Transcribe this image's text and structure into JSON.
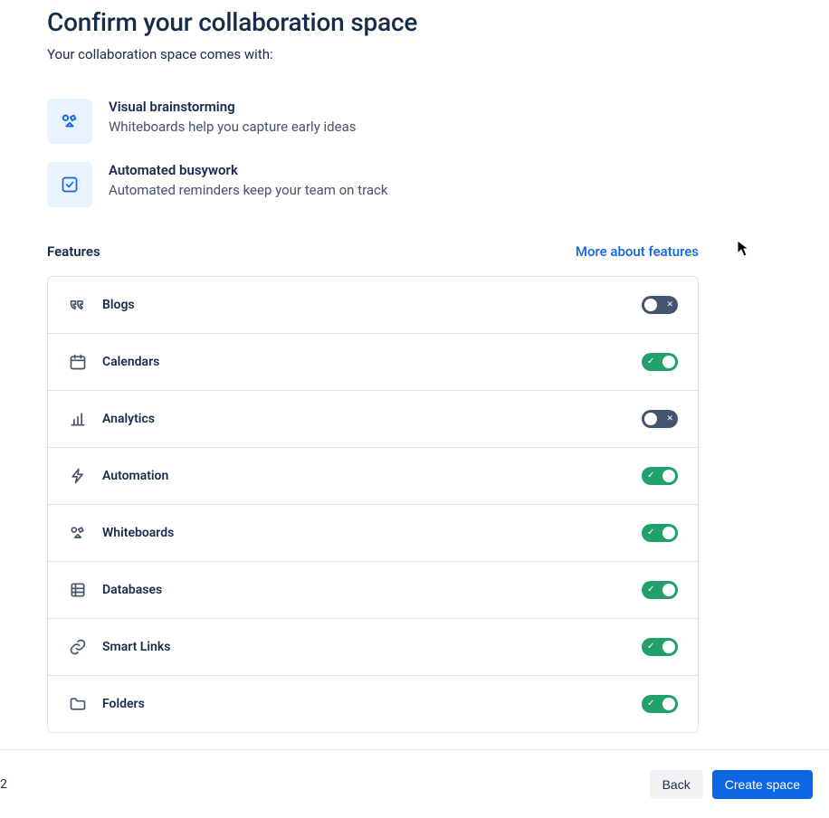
{
  "header": {
    "title": "Confirm your collaboration space",
    "subtitle": "Your collaboration space comes with:"
  },
  "included": [
    {
      "icon": "whiteboard",
      "title": "Visual brainstorming",
      "desc": "Whiteboards help you capture early ideas"
    },
    {
      "icon": "check-square",
      "title": "Automated busywork",
      "desc": "Automated reminders keep your team on track"
    }
  ],
  "featuresSection": {
    "label": "Features",
    "moreLink": "More about features"
  },
  "features": [
    {
      "icon": "quote",
      "name": "Blogs",
      "enabled": false
    },
    {
      "icon": "calendar",
      "name": "Calendars",
      "enabled": true
    },
    {
      "icon": "analytics",
      "name": "Analytics",
      "enabled": false
    },
    {
      "icon": "bolt",
      "name": "Automation",
      "enabled": true
    },
    {
      "icon": "whiteboard",
      "name": "Whiteboards",
      "enabled": true
    },
    {
      "icon": "database",
      "name": "Databases",
      "enabled": true
    },
    {
      "icon": "link",
      "name": "Smart Links",
      "enabled": true
    },
    {
      "icon": "folder",
      "name": "Folders",
      "enabled": true
    }
  ],
  "footer": {
    "pageIndicator": "2",
    "back": "Back",
    "create": "Create space"
  }
}
